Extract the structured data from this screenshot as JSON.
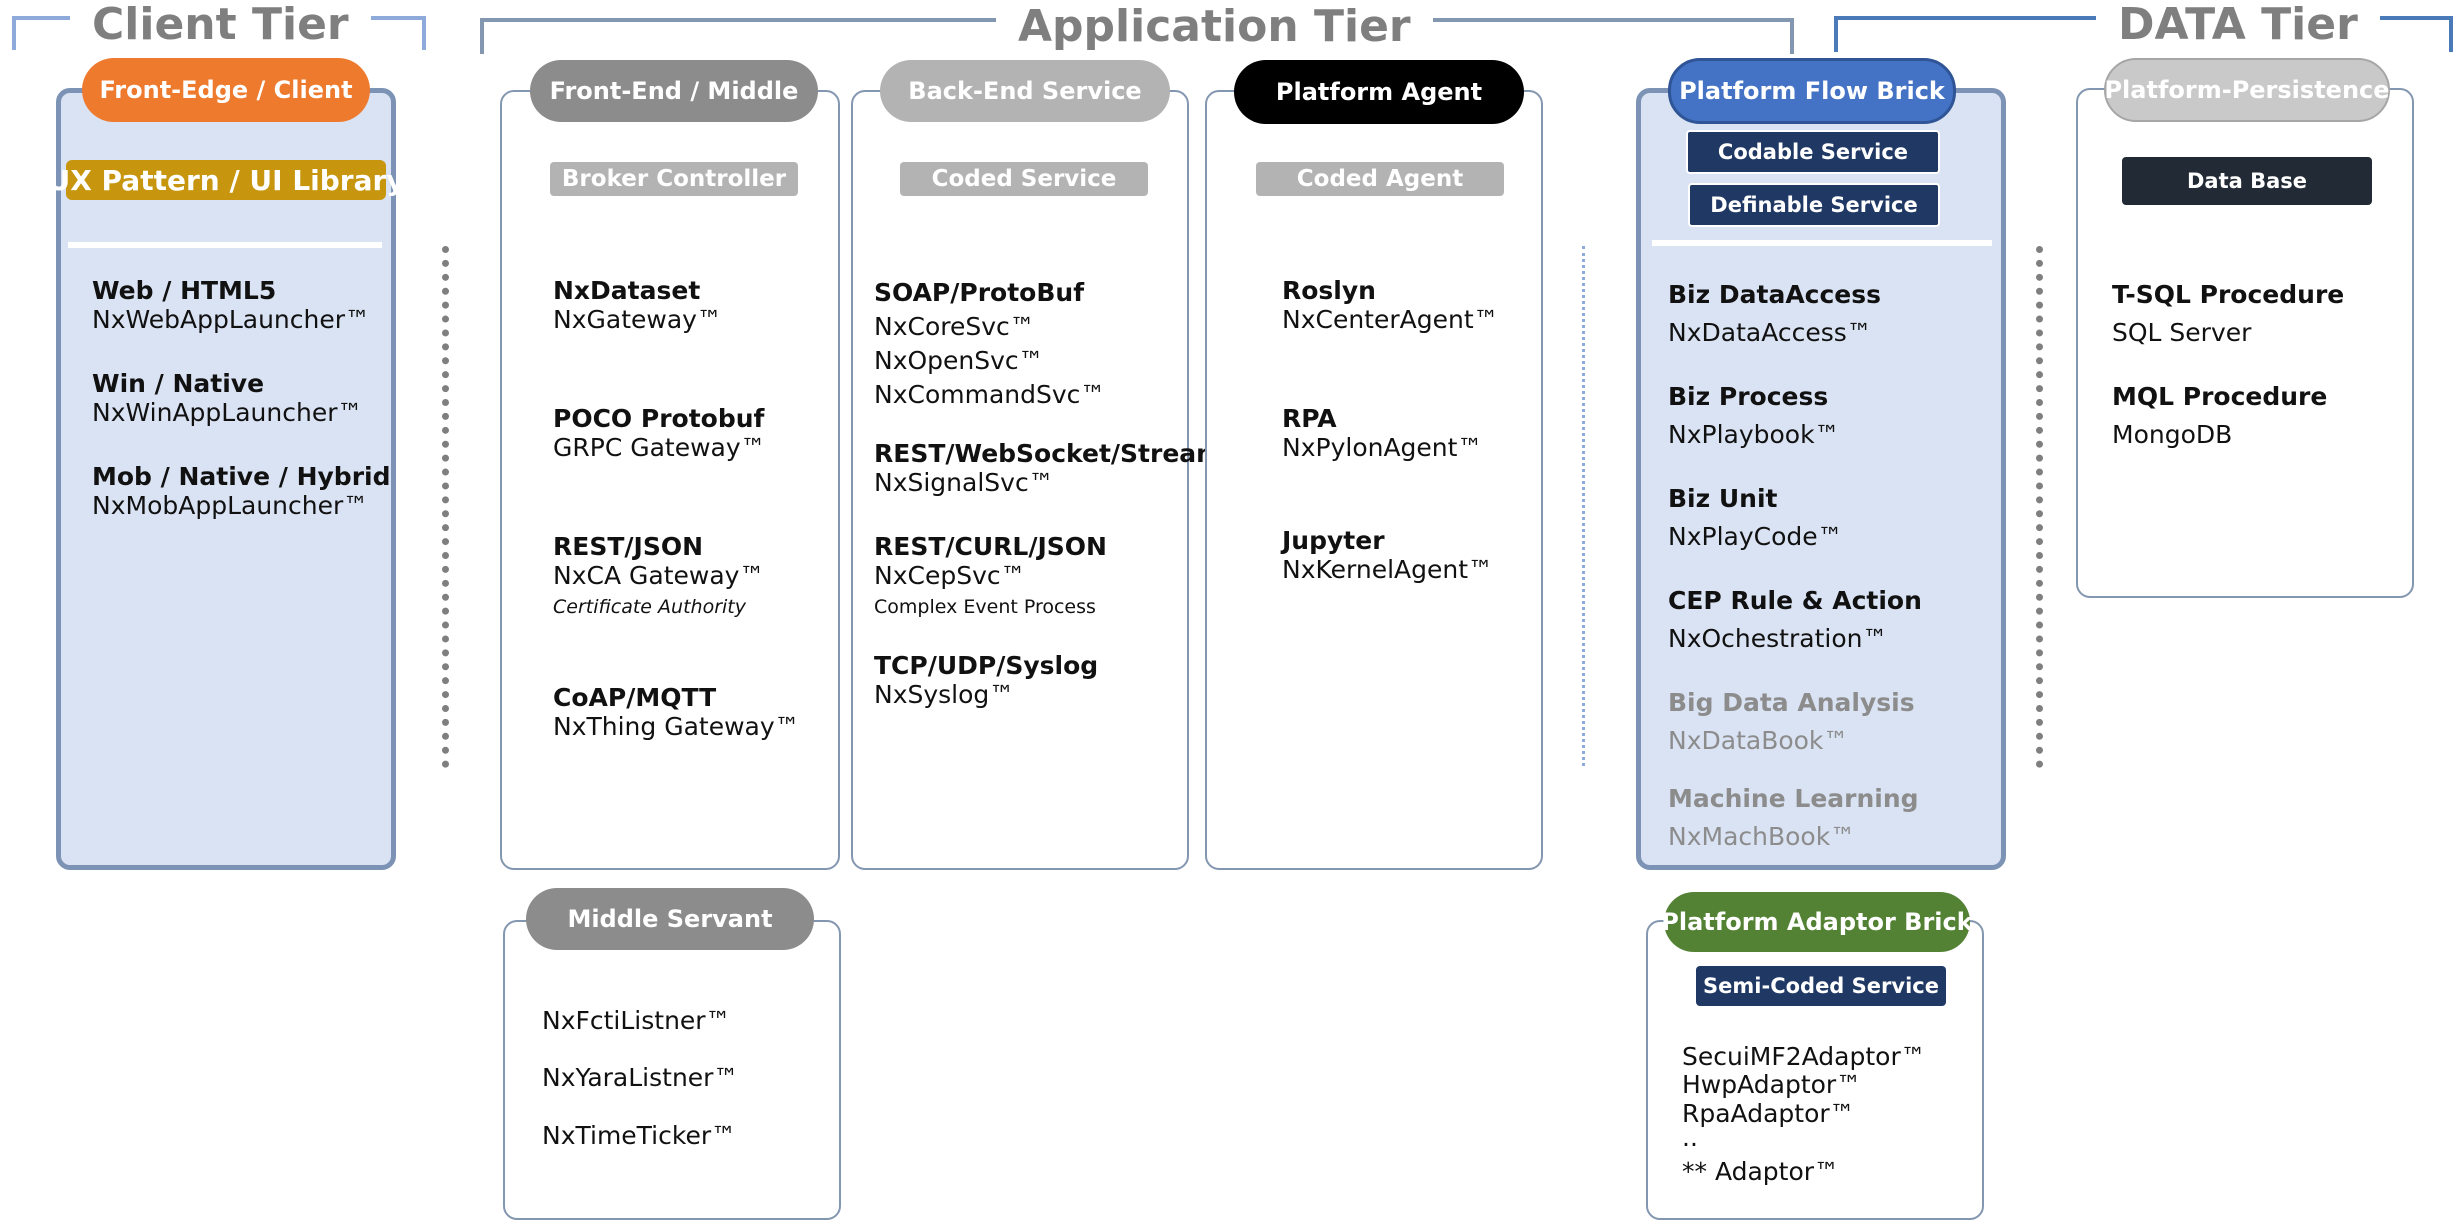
{
  "tiers": {
    "client": "Client Tier",
    "application": "Application Tier",
    "data": "DATA Tier"
  },
  "client": {
    "header": "Front-Edge / Client",
    "tag": "UX Pattern / UI Library",
    "items": [
      {
        "title": "Web / HTML5",
        "value": "NxWebAppLauncher™"
      },
      {
        "title": "Win / Native",
        "value": "NxWinAppLauncher™"
      },
      {
        "title": "Mob / Native / Hybrid",
        "value": "NxMobAppLauncher™"
      }
    ]
  },
  "frontend": {
    "header": "Front-End / Middle",
    "tag": "Broker Controller",
    "items": [
      {
        "title": "NxDataset",
        "value": "NxGateway™"
      },
      {
        "title": "POCO Protobuf",
        "value": "GRPC Gateway™"
      },
      {
        "title": "REST/JSON",
        "value": "NxCA Gateway™",
        "note": "Certificate Authority"
      },
      {
        "title": "CoAP/MQTT",
        "value": "NxThing Gateway™"
      }
    ]
  },
  "backend": {
    "header": "Back-End Service",
    "tag": "Coded Service",
    "items": [
      {
        "title": "SOAP/ProtoBuf",
        "values": [
          "NxCoreSvc™",
          "NxOpenSvc™",
          "NxCommandSvc™"
        ]
      },
      {
        "title": "REST/WebSocket/Stream",
        "values": [
          "NxSignalSvc™"
        ]
      },
      {
        "title": "REST/CURL/JSON",
        "values": [
          "NxCepSvc™"
        ],
        "note": "Complex Event Process"
      },
      {
        "title": "TCP/UDP/Syslog",
        "values": [
          "NxSyslog™"
        ]
      }
    ]
  },
  "agent": {
    "header": "Platform Agent",
    "tag": "Coded Agent",
    "items": [
      {
        "title": "Roslyn",
        "value": "NxCenterAgent™"
      },
      {
        "title": "RPA",
        "value": "NxPylonAgent™"
      },
      {
        "title": "Jupyter",
        "value": "NxKernelAgent™"
      }
    ]
  },
  "middle_servant": {
    "header": "Middle Servant",
    "items": [
      "NxFctiListner™",
      "NxYaraListner™",
      "NxTimeTicker™"
    ]
  },
  "flow_brick": {
    "header": "Platform Flow Brick",
    "tags": [
      "Codable Service",
      "Definable Service"
    ],
    "items": [
      {
        "title": "Biz DataAccess",
        "value": "NxDataAccess™"
      },
      {
        "title": "Biz Process",
        "value": "NxPlaybook™"
      },
      {
        "title": "Biz Unit",
        "value": "NxPlayCode™"
      },
      {
        "title": "CEP Rule & Action",
        "value": "NxOchestration™"
      },
      {
        "title": "Big Data Analysis",
        "value": "NxDataBook™"
      },
      {
        "title": "Machine Learning",
        "value": "NxMachBook™"
      }
    ]
  },
  "adaptor_brick": {
    "header": "Platform Adaptor Brick",
    "tag": "Semi-Coded Service",
    "items": [
      "SecuiMF2Adaptor™",
      "HwpAdaptor™",
      "RpaAdaptor™",
      "..",
      "** Adaptor™"
    ]
  },
  "persistence": {
    "header": "Platform-Persistence",
    "tag": "Data Base",
    "items": [
      {
        "title": "T-SQL Procedure",
        "value": "SQL Server"
      },
      {
        "title": "MQL Procedure",
        "value": "MongoDB"
      }
    ]
  },
  "colors": {
    "client_orange": "#ee7a2e",
    "gold_tag": "#c7960e",
    "grey_header": "#8c8c8c",
    "light_grey_header": "#b3b3b3",
    "black_header": "#000000",
    "flow_blue": "#4472c4",
    "navy_tag": "#1f3864",
    "adaptor_green": "#548235",
    "db_dark": "#222a35",
    "tier_line": "#8497b0",
    "data_line": "#4a7ab8"
  }
}
